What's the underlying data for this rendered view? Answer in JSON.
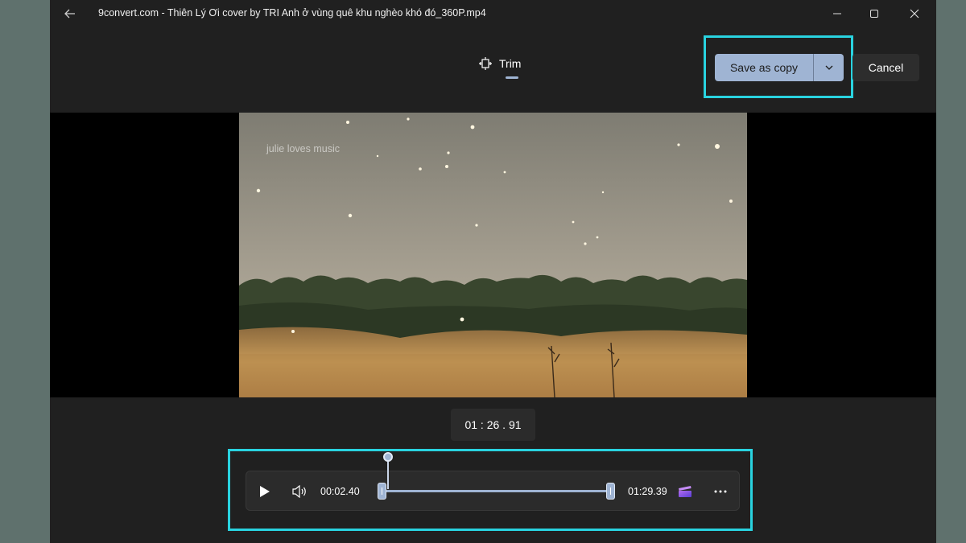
{
  "window": {
    "title": "9convert.com - Thiên Lý Ơi cover by TRI  Anh ở vùng quê khu nghèo khó đó_360P.mp4"
  },
  "toolbar": {
    "tab_label": "Trim",
    "save_label": "Save as copy",
    "cancel_label": "Cancel"
  },
  "video": {
    "watermark": "julie loves music"
  },
  "timeline": {
    "current_time": "01 : 26 . 91",
    "start_time": "00:02.40",
    "end_time": "01:29.39"
  },
  "colors": {
    "accent": "#9fb4d3",
    "highlight": "#29d3e0",
    "window_bg": "#202020"
  },
  "icons": [
    "back-arrow-icon",
    "minimize-icon",
    "maximize-icon",
    "close-icon",
    "trim-icon",
    "chevron-down-icon",
    "play-icon",
    "volume-icon",
    "clapperboard-icon",
    "more-icon"
  ]
}
